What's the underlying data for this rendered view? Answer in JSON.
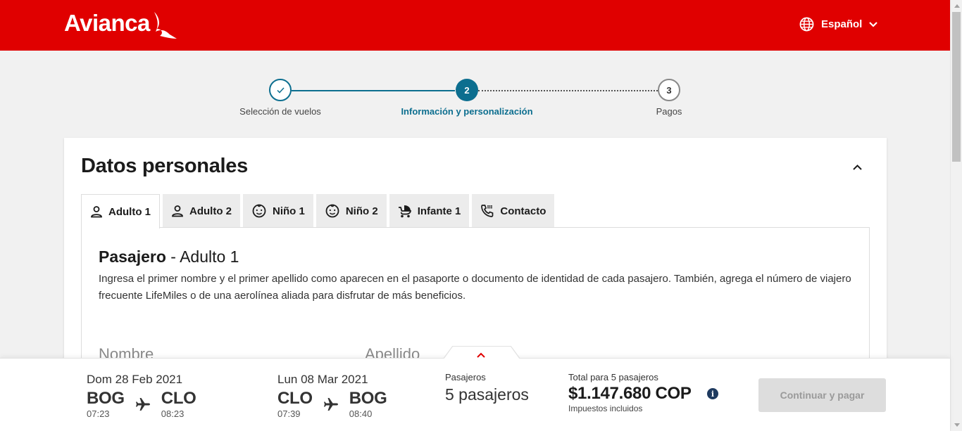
{
  "header": {
    "brand": "Avianca",
    "language": "Español"
  },
  "stepper": {
    "steps": [
      {
        "number": "✓",
        "label": "Selección de vuelos",
        "state": "done"
      },
      {
        "number": "2",
        "label": "Información y personalización",
        "state": "active"
      },
      {
        "number": "3",
        "label": "Pagos",
        "state": "pending"
      }
    ]
  },
  "section": {
    "title": "Datos personales"
  },
  "tabs": [
    {
      "label": "Adulto 1",
      "icon": "person-icon",
      "active": true
    },
    {
      "label": "Adulto 2",
      "icon": "person-icon",
      "active": false
    },
    {
      "label": "Niño 1",
      "icon": "child-face-icon",
      "active": false
    },
    {
      "label": "Niño 2",
      "icon": "child-face-icon",
      "active": false
    },
    {
      "label": "Infante 1",
      "icon": "stroller-icon",
      "active": false
    },
    {
      "label": "Contacto",
      "icon": "phone-icon",
      "active": false
    }
  ],
  "passenger": {
    "title_bold": "Pasajero",
    "title_rest": " - Adulto 1",
    "description": "Ingresa el primer nombre y el primer apellido como aparecen en el pasaporte o documento de identidad de cada pasajero. También, agrega el número de viajero frecuente LifeMiles o de una aerolínea aliada para disfrutar de más beneficios.",
    "field_first_name": "Nombre",
    "field_last_name": "Apellido"
  },
  "summary": {
    "outbound": {
      "date": "Dom 28 Feb 2021",
      "from": "BOG",
      "from_time": "07:23",
      "to": "CLO",
      "to_time": "08:23"
    },
    "return": {
      "date": "Lun 08 Mar 2021",
      "from": "CLO",
      "from_time": "07:39",
      "to": "BOG",
      "to_time": "08:40"
    },
    "passengers_label": "Pasajeros",
    "passengers_value": "5 pasajeros",
    "total_label": "Total para 5 pasajeros",
    "total_price": "$1.147.680 COP",
    "taxes_note": "Impuestos incluidos",
    "pay_button": "Continuar y pagar"
  },
  "colors": {
    "brand_red": "#e00000",
    "accent_teal": "#0c6e8f"
  }
}
